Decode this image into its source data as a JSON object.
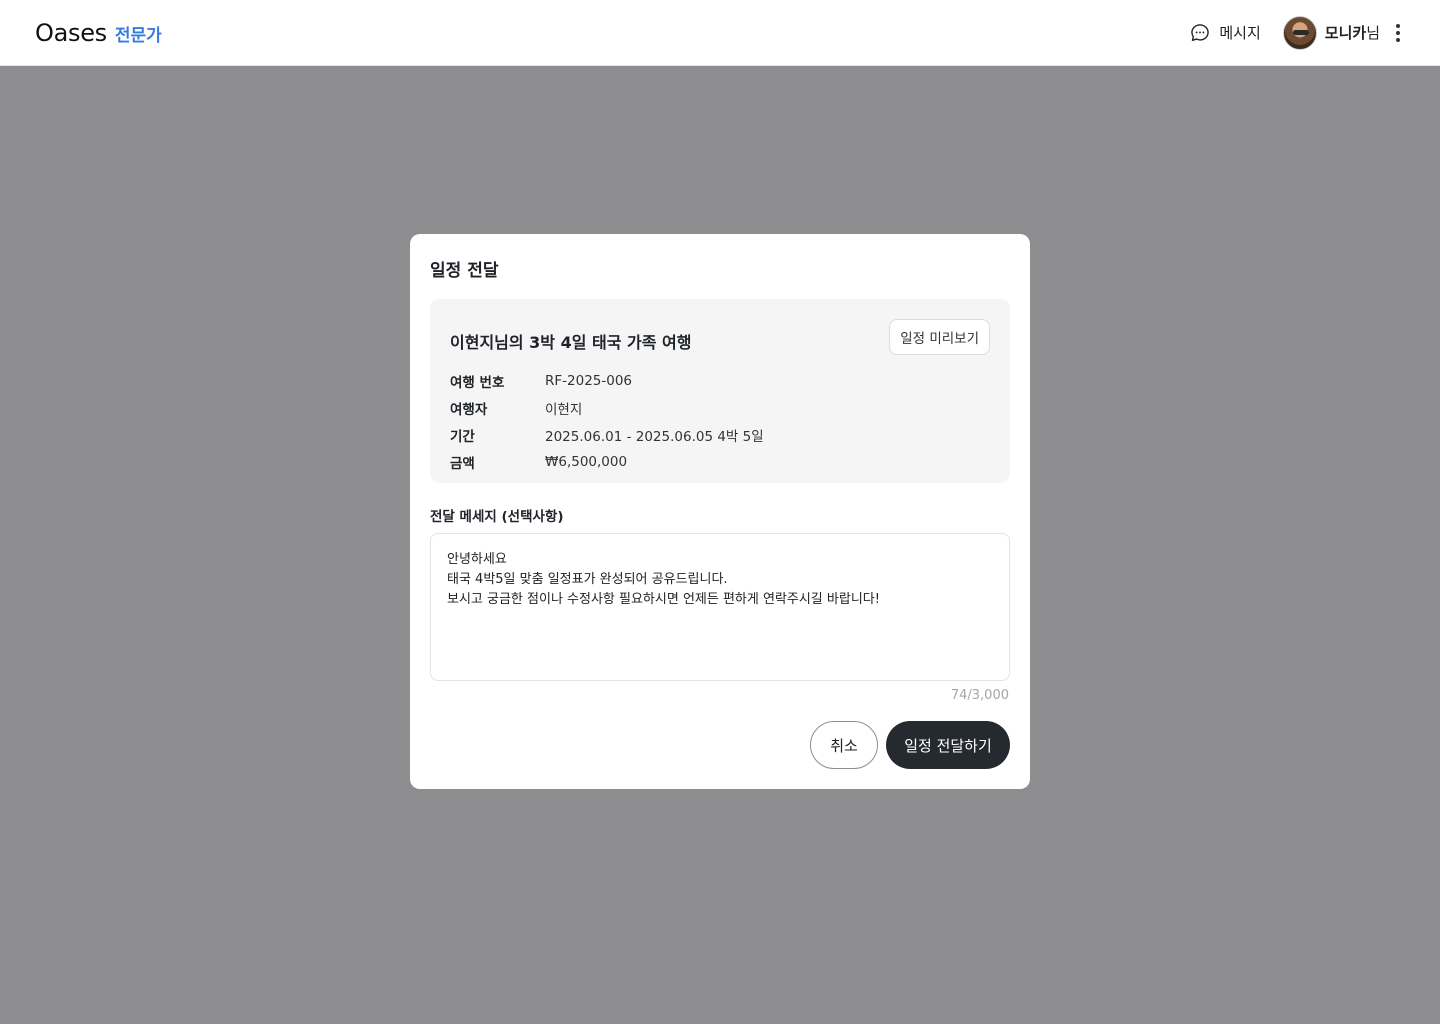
{
  "header": {
    "brand": "Oases",
    "brand_sub": "전문가",
    "message_label": "메시지",
    "user_name": "모니카",
    "user_suffix": "님"
  },
  "modal": {
    "title": "일정 전달",
    "trip": {
      "title": "이현지님의 3박 4일 태국 가족 여행",
      "preview_button": "일정 미리보기",
      "rows": [
        {
          "label": "여행 번호",
          "value": "RF-2025-006"
        },
        {
          "label": "여행자",
          "value": "이현지"
        },
        {
          "label": "기간",
          "value": "2025.06.01 - 2025.06.05 4박 5일"
        },
        {
          "label": "금액",
          "value": "₩6,500,000"
        }
      ]
    },
    "message_field": {
      "label": "전달 메세지 (선택사항)",
      "value": "안녕하세요\n태국 4박5일 맞춤 일정표가 완성되어 공유드립니다.\n보시고 궁금한 점이나 수정사항 필요하시면 언제든 편하게 연락주시길 바랍니다!",
      "counter": "74/3,000"
    },
    "cancel_button": "취소",
    "submit_button": "일정 전달하기"
  },
  "icons": {
    "message": "chat-bubble-icon",
    "more": "more-vertical-icon"
  },
  "colors": {
    "accent": "#3a7be0",
    "overlay": "#8e8e90",
    "primary_button": "#252a31"
  }
}
